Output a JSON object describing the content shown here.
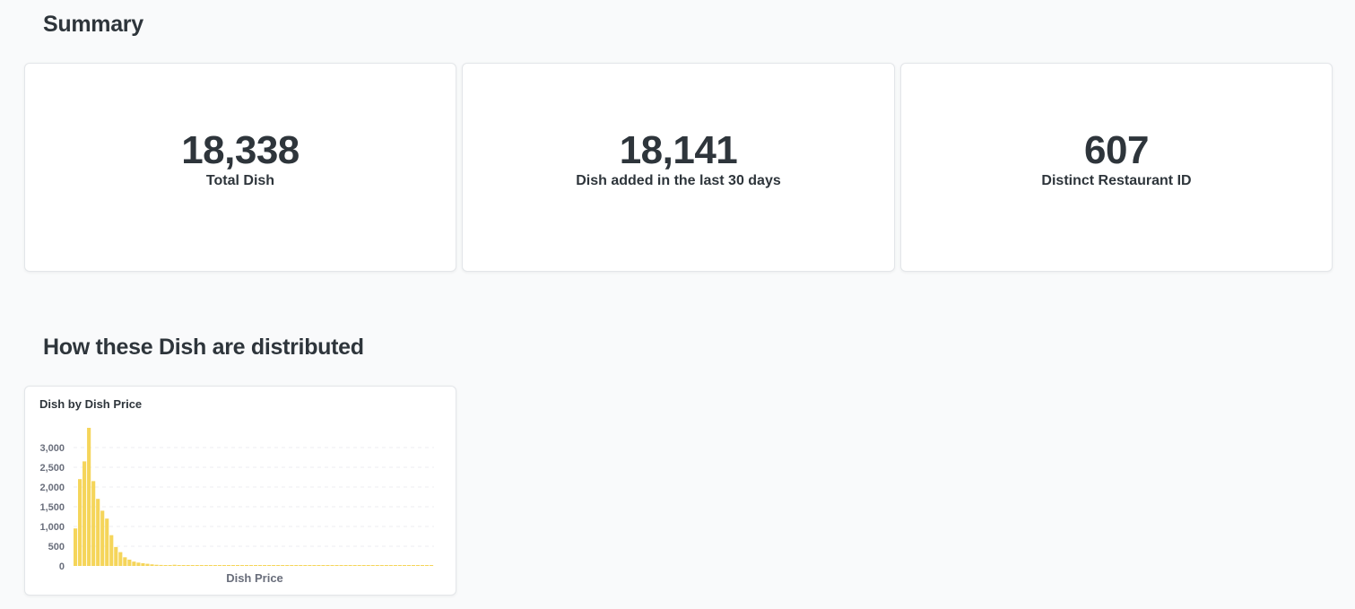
{
  "summary": {
    "title": "Summary",
    "cards": [
      {
        "value": "18,338",
        "label": "Total Dish"
      },
      {
        "value": "18,141",
        "label": "Dish added in the last 30 days"
      },
      {
        "value": "607",
        "label": "Distinct Restaurant ID"
      }
    ]
  },
  "distribution": {
    "title": "How these Dish are distributed"
  },
  "colors": {
    "bar": "#f5d55a",
    "text": "#2e353b",
    "axis_text": "#696e7b",
    "grid": "#eceef0"
  },
  "chart_data": {
    "type": "bar",
    "title": "Dish by Dish Price",
    "xlabel": "Dish Price",
    "ylabel": "",
    "ylim": [
      0,
      3500
    ],
    "yticks": [
      0,
      500,
      1000,
      1500,
      2000,
      2500,
      3000
    ],
    "ytick_labels": [
      "0",
      "500",
      "1,000",
      "1,500",
      "2,000",
      "2,500",
      "3,000"
    ],
    "grid": true,
    "series": [
      {
        "values": [
          950,
          2200,
          2650,
          3500,
          2150,
          1700,
          1400,
          1200,
          780,
          480,
          350,
          220,
          160,
          110,
          85,
          70,
          55,
          40,
          30,
          25,
          20,
          15,
          30,
          15,
          15,
          10,
          10,
          8,
          8,
          6,
          6,
          5,
          5,
          5,
          4,
          4,
          4,
          4,
          3,
          3,
          3,
          3,
          3,
          2,
          2,
          2,
          2,
          2,
          2,
          2,
          2,
          2,
          2,
          2,
          2,
          2,
          2,
          2,
          2,
          2,
          2,
          2,
          2,
          2,
          2,
          2,
          2,
          2,
          2,
          2,
          2,
          2,
          2,
          2,
          2,
          2,
          2,
          2,
          2,
          2
        ]
      }
    ]
  }
}
